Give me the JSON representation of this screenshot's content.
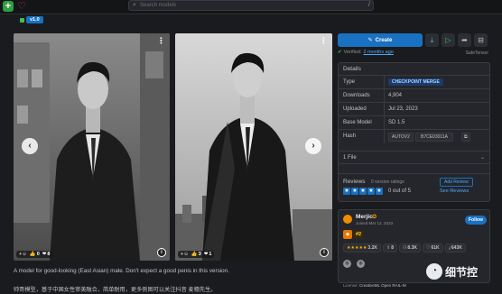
{
  "topbar": {
    "search_placeholder": "Search models",
    "search_shortcut": "/"
  },
  "version": {
    "label": "v1.0"
  },
  "gallery": {
    "images": [
      {
        "reactions": {
          "likes": "0",
          "hearts": "8"
        }
      },
      {
        "reactions": {
          "likes": "3",
          "hearts": "1"
        }
      }
    ]
  },
  "description": {
    "en": "A model for good-looking (East Asian) male. Don't expect a good penis in this version.",
    "zh": "帅哥模型，基于中国女性审美融合，简单耐用，更多例图可以关注抖音 麦穗先生。"
  },
  "sidebar": {
    "create_label": "Create",
    "verified_text": "Verified:",
    "verified_when": "2 months ago",
    "safetensor": "SafeTensor",
    "details": {
      "title": "Details",
      "rows": {
        "type": {
          "key": "Type",
          "value": "CHECKPOINT MERGE"
        },
        "downloads": {
          "key": "Downloads",
          "value": "4,904"
        },
        "uploaded": {
          "key": "Uploaded",
          "value": "Jul 23, 2023"
        },
        "base_model": {
          "key": "Base Model",
          "value": "SD 1.5"
        },
        "hash": {
          "key": "Hash",
          "algo": "AUTOV2",
          "value": "B7CE03011A"
        }
      }
    },
    "files": {
      "label": "1 File"
    },
    "reviews": {
      "title": "Reviews",
      "count": "0 version ratings",
      "score": "0 out of 5",
      "add": "Add Review",
      "see": "See Reviews"
    },
    "author": {
      "name": "Merjic",
      "joined": "Joined Mar 12, 2023",
      "follow": "Follow",
      "rank": "#2",
      "stats": {
        "rating": "3.2K",
        "uploads": "8",
        "followers": "8.3K",
        "likes": "61K",
        "downloads": "643K"
      }
    },
    "license": {
      "prefix": "License:",
      "name": "CreativeML Open RAIL-M"
    }
  },
  "watermark": {
    "text": "细节控"
  },
  "colors": {
    "accent": "#1971c2",
    "background": "#1a1b1e",
    "panel": "#25262b",
    "success": "#40c057",
    "heart": "#e03131"
  }
}
